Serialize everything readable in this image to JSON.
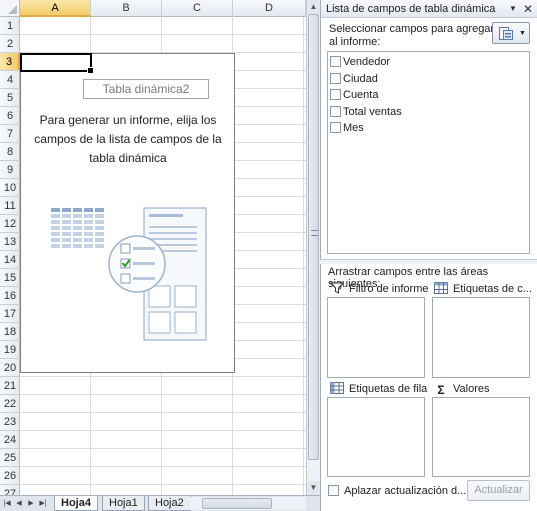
{
  "sheet": {
    "columns": [
      {
        "label": "A",
        "selected": true
      },
      {
        "label": "B",
        "selected": false
      },
      {
        "label": "C",
        "selected": false
      },
      {
        "label": "D",
        "selected": false
      }
    ],
    "rows": [
      "1",
      "2",
      "3",
      "4",
      "5",
      "6",
      "7",
      "8",
      "9",
      "10",
      "11",
      "12",
      "13",
      "14",
      "15",
      "16",
      "17",
      "18",
      "19",
      "20",
      "21",
      "22",
      "23",
      "24",
      "25",
      "26",
      "27"
    ],
    "selected_row": "3",
    "pivot_placeholder": {
      "name": "Tabla dinámica2",
      "message": "Para generar un informe, elija los campos de la lista de campos de la tabla dinámica"
    },
    "tabs": [
      {
        "label": "Hoja4",
        "active": true
      },
      {
        "label": "Hoja1",
        "active": false
      },
      {
        "label": "Hoja2",
        "active": false
      }
    ]
  },
  "panel": {
    "title": "Lista de campos de tabla dinámica",
    "select_label": "Seleccionar campos para agregar al informe:",
    "fields": [
      "Vendedor",
      "Ciudad",
      "Cuenta",
      "Total ventas",
      "Mes"
    ],
    "drag_label": "Arrastrar campos entre las áreas siguientes:",
    "areas": {
      "report_filter": "Filtro de informe",
      "column_labels": "Etiquetas de c...",
      "row_labels": "Etiquetas de fila",
      "values": "Valores"
    },
    "defer_label": "Aplazar actualización d...",
    "update_button": "Actualizar"
  },
  "icons": {
    "close": "close-icon",
    "dropdown": "chevron-down-icon",
    "layout": "field-list-layout-icon",
    "filter": "filter-icon",
    "table": "table-icon",
    "sigma": "sigma-icon"
  },
  "colors": {
    "selected_header": "#f4cc6a",
    "gridline": "#dadcdd",
    "panel_border": "#a3acb9"
  }
}
